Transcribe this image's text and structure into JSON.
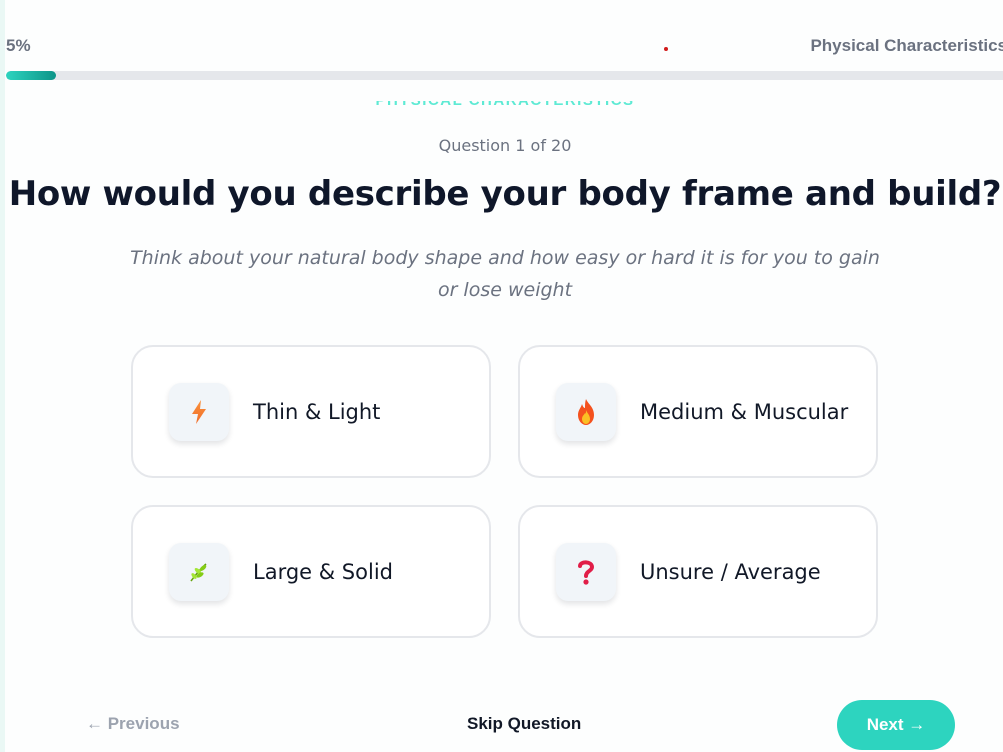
{
  "progress": {
    "percent_label": "5%",
    "fraction": 0.05,
    "category": "Physical Characteristics"
  },
  "section": {
    "category_label": "Physical Characteristics"
  },
  "question": {
    "counter": "Question 1 of 20",
    "title": "How would you describe your body frame and build?",
    "subtitle": "Think about your natural body shape and how easy or hard it is for you to gain or lose weight"
  },
  "options": [
    {
      "label": "Thin & Light",
      "icon": "lightning-icon"
    },
    {
      "label": "Medium & Muscular",
      "icon": "fire-icon"
    },
    {
      "label": "Large & Solid",
      "icon": "leaf-icon"
    },
    {
      "label": "Unsure / Average",
      "icon": "question-mark-icon"
    }
  ],
  "nav": {
    "previous_label": "← Previous",
    "skip_label": "Skip Question",
    "next_label": "Next →"
  },
  "colors": {
    "accent": "#2dd4bf",
    "accent_dark": "#0d9488",
    "text_dark": "#0f172a",
    "muted": "#6b7280"
  }
}
